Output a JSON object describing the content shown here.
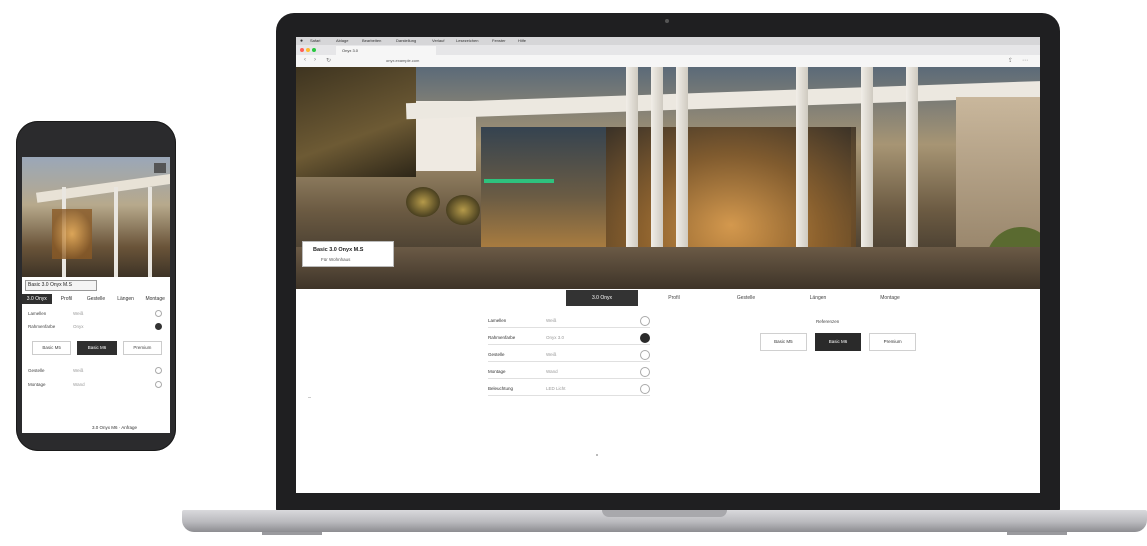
{
  "phone": {
    "model_label": "Basic 3.0 Onyx M.S",
    "tabs": [
      {
        "label": "3.0 Onyx",
        "active": true
      },
      {
        "label": "Profil",
        "active": false
      },
      {
        "label": "Gestelle",
        "active": false
      },
      {
        "label": "Längen",
        "active": false
      },
      {
        "label": "Montage",
        "active": false
      }
    ],
    "rows_top": [
      {
        "label": "Lamellen",
        "value": "Weiß",
        "icon": "light"
      },
      {
        "label": "Rahmenfarbe",
        "value": "Onyx",
        "icon": "dark"
      }
    ],
    "buttons": [
      {
        "label": "Basic M5",
        "active": false
      },
      {
        "label": "Basic M6",
        "active": true
      },
      {
        "label": "Premium",
        "active": false
      }
    ],
    "rows_bottom": [
      {
        "label": "Gestelle",
        "value": "Weiß",
        "icon": "light"
      },
      {
        "label": "Montage",
        "value": "Wand",
        "icon": "light"
      }
    ],
    "bottom_text": "3.0 Onyx M6 · Anfrage"
  },
  "browser": {
    "os_menu": [
      "Safari",
      "Ablage",
      "Bearbeiten",
      "Darstellung",
      "Verlauf",
      "Lesezeichen",
      "Fenster",
      "Hilfe"
    ],
    "tab_title": "Onyx 3.0",
    "url": "onyx.example.com"
  },
  "hero": {
    "model_title": "Basic 3.0 Onyx M.S",
    "model_subtitle": "Für Wohnhaus"
  },
  "config_tabs": [
    {
      "label": "3.0 Onyx",
      "active": true
    },
    {
      "label": "Profil",
      "active": false
    },
    {
      "label": "Gestelle",
      "active": false
    },
    {
      "label": "Längen",
      "active": false
    },
    {
      "label": "Montage",
      "active": false
    }
  ],
  "options": [
    {
      "label": "Lamellen",
      "value": "Weiß",
      "icon": "light"
    },
    {
      "label": "Rahmenfarbe",
      "value": "Onyx 3.0",
      "icon": "dark"
    },
    {
      "label": "Gestelle",
      "value": "Weiß",
      "icon": "light"
    },
    {
      "label": "Montage",
      "value": "Wand",
      "icon": "light"
    },
    {
      "label": "Beleuchtung",
      "value": "LED Licht",
      "icon": "light"
    }
  ],
  "reference": {
    "title": "Referenzen",
    "buttons": [
      {
        "label": "Basic M5",
        "active": false
      },
      {
        "label": "Basic M6",
        "active": true
      },
      {
        "label": "Premium",
        "active": false
      }
    ]
  }
}
